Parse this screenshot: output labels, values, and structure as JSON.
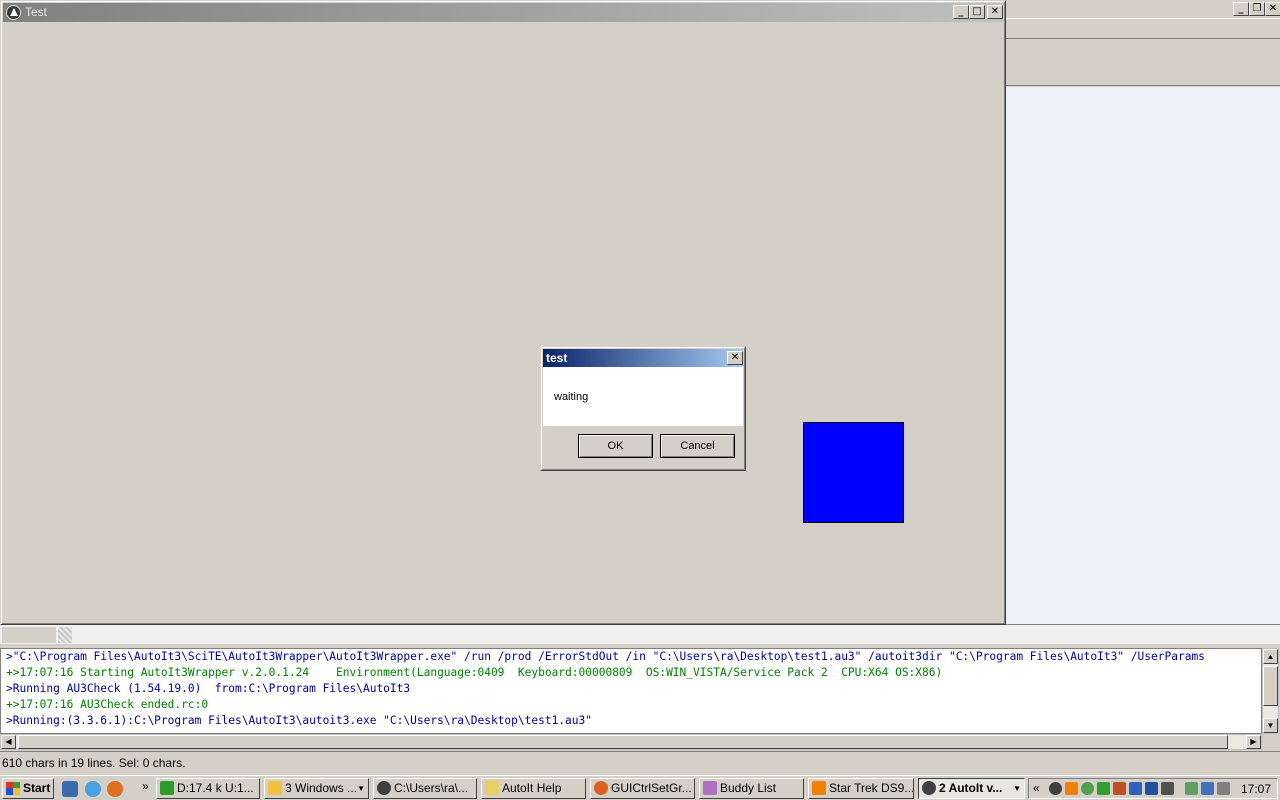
{
  "test_window": {
    "title": "Test"
  },
  "msgbox": {
    "title": "test",
    "message": "waiting",
    "ok_label": "OK",
    "cancel_label": "Cancel",
    "close_glyph": "✕"
  },
  "window_buttons": {
    "minimize": "_",
    "maximize": "□",
    "close": "✕",
    "restore": "❐"
  },
  "output": {
    "lines": [
      {
        "text": ">\"C:\\Program Files\\AutoIt3\\SciTE\\AutoIt3Wrapper\\AutoIt3Wrapper.exe\" /run /prod /ErrorStdOut /in \"C:\\Users\\ra\\Desktop\\test1.au3\" /autoit3dir \"C:\\Program Files\\AutoIt3\" /UserParams",
        "color": "blue"
      },
      {
        "text": "+>17:07:16 Starting AutoIt3Wrapper v.2.0.1.24    Environment(Language:0409  Keyboard:00000809  OS:WIN_VISTA/Service Pack 2  CPU:X64 OS:X86)",
        "color": "green"
      },
      {
        "text": ">Running AU3Check (1.54.19.0)  from:C:\\Program Files\\AutoIt3",
        "color": "blue"
      },
      {
        "text": "+>17:07:16 AU3Check ended.rc:0",
        "color": "green"
      },
      {
        "text": ">Running:(3.3.6.1):C:\\Program Files\\AutoIt3\\autoit3.exe \"C:\\Users\\ra\\Desktop\\test1.au3\"",
        "color": "blue"
      }
    ]
  },
  "status_bar": {
    "text": "610 chars in 19 lines. Sel: 0 chars."
  },
  "taskbar": {
    "start_label": "Start",
    "overflow_glyph": "»",
    "items": [
      {
        "label": "D:17.4 k U:1...",
        "icon_color": "#2a9d2a",
        "active": false
      },
      {
        "label": "3 Windows ...",
        "icon_color": "#f0c040",
        "active": false,
        "dropdown": true
      },
      {
        "label": "C:\\Users\\ra\\...",
        "icon_color": "#404040",
        "active": false
      },
      {
        "label": "AutoIt Help",
        "icon_color": "#e8d060",
        "active": false
      },
      {
        "label": "GUICtrlSetGr...",
        "icon_color": "#e06020",
        "active": false
      },
      {
        "label": "Buddy List",
        "icon_color": "#b070c0",
        "active": false
      },
      {
        "label": "Star Trek DS9...",
        "icon_color": "#f08000",
        "active": false
      },
      {
        "label": "2 AutoIt v...",
        "icon_color": "#404040",
        "active": true,
        "dropdown": true
      }
    ],
    "tray_chevron": "«",
    "clock": "17:07"
  },
  "colors": {
    "blue_square": "#0000ff",
    "output_blue": "#0000a0",
    "output_green": "#008000"
  }
}
